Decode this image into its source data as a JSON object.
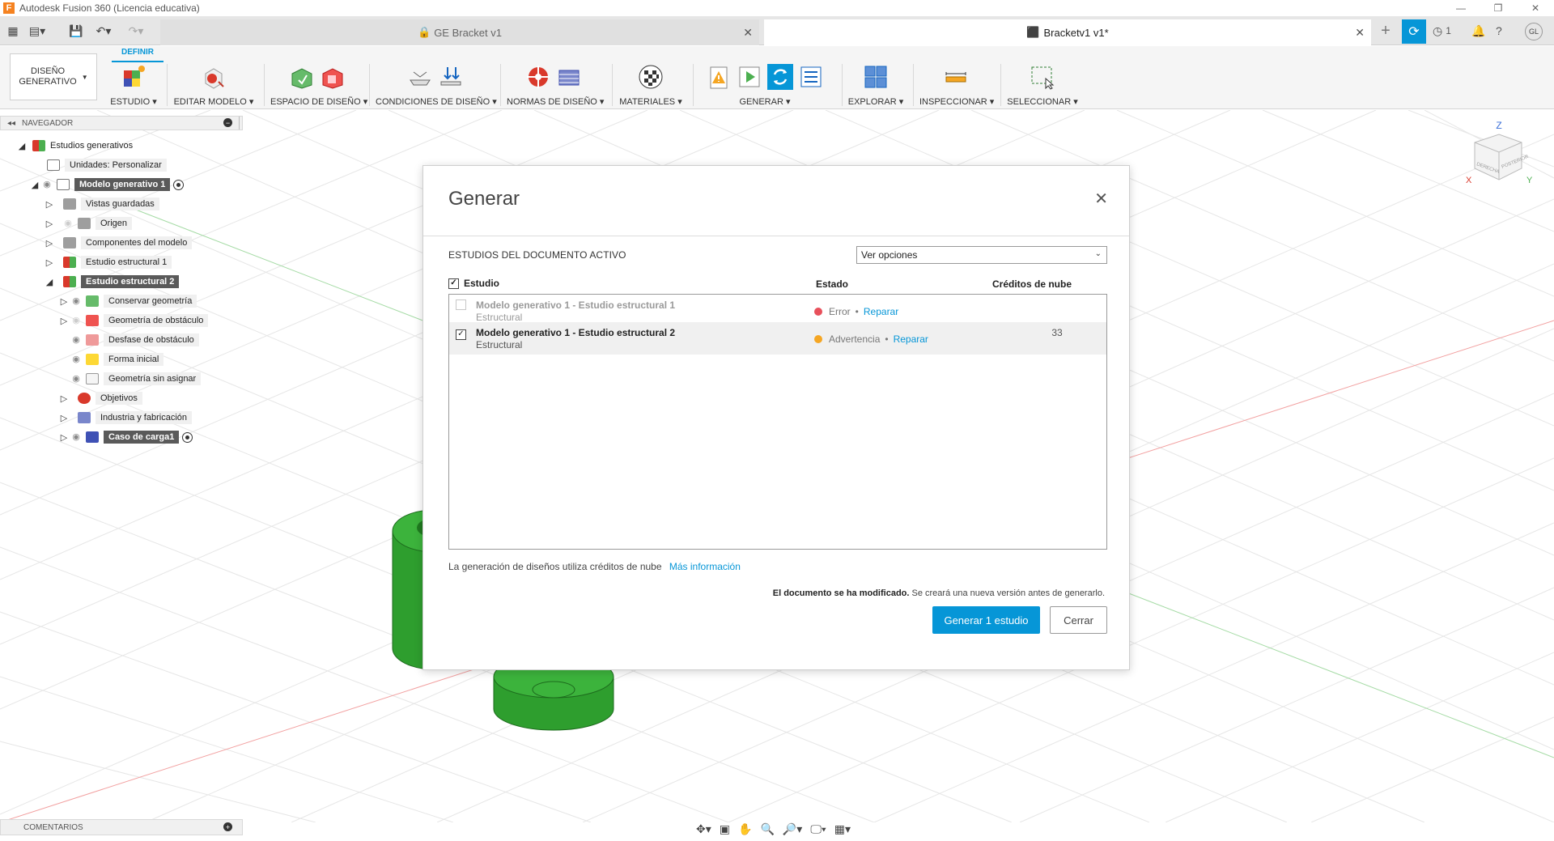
{
  "window": {
    "title": "Autodesk Fusion 360 (Licencia educativa)",
    "app_icon": "F",
    "controls": [
      "minimize-icon",
      "restore-icon",
      "close-icon"
    ]
  },
  "tabs": [
    {
      "label": "GE Bracket v1",
      "icon": "lock-icon",
      "active": false
    },
    {
      "label": "Bracketv1 v1*",
      "icon": "cube-icon",
      "active": true
    }
  ],
  "topbar": {
    "job_count": "1",
    "user_initials": "GL"
  },
  "ribbon": {
    "workspace_line1": "DISEÑO",
    "workspace_line2": "GENERATIVO",
    "active_tab": "DEFINIR",
    "groups": [
      {
        "label": "ESTUDIO ▾"
      },
      {
        "label": "EDITAR MODELO ▾"
      },
      {
        "label": "ESPACIO DE DISEÑO ▾"
      },
      {
        "label": "CONDICIONES DE DISEÑO ▾"
      },
      {
        "label": "NORMAS DE DISEÑO ▾"
      },
      {
        "label": "MATERIALES ▾"
      },
      {
        "label": "GENERAR ▾"
      },
      {
        "label": "EXPLORAR ▾"
      },
      {
        "label": "INSPECCIONAR ▾"
      },
      {
        "label": "SELECCIONAR ▾"
      }
    ]
  },
  "browser": {
    "title": "NAVEGADOR",
    "nodes": [
      {
        "label": "Estudios generativos",
        "expander": "◢",
        "icon_color": "#d9392b"
      },
      {
        "label": "Unidades: Personalizar",
        "expander": "",
        "icon_color": "#ffffff"
      },
      {
        "label": "Modelo generativo 1",
        "expander": "◢",
        "icon_color": "#ffffff",
        "selected": true
      },
      {
        "label": "Vistas guardadas",
        "expander": "▷",
        "icon_color": "#9e9e9e"
      },
      {
        "label": "Origen",
        "expander": "▷",
        "icon_color": "#9e9e9e"
      },
      {
        "label": "Componentes del modelo",
        "expander": "▷",
        "icon_color": "#9e9e9e"
      },
      {
        "label": "Estudio estructural 1",
        "expander": "▷",
        "icon_color": "#d9392b"
      },
      {
        "label": "Estudio estructural 2",
        "expander": "◢",
        "icon_color": "#d9392b",
        "selected": true
      },
      {
        "label": "Conservar geometría",
        "expander": "▷",
        "icon_color": "#4caf50"
      },
      {
        "label": "Geometría de obstáculo",
        "expander": "▷",
        "icon_color": "#e53935"
      },
      {
        "label": "Desfase de obstáculo",
        "expander": "",
        "icon_color": "#ef9a9a"
      },
      {
        "label": "Forma inicial",
        "expander": "",
        "icon_color": "#fdd835"
      },
      {
        "label": "Geometría sin asignar",
        "expander": "",
        "icon_color": "#e0e0e0"
      },
      {
        "label": "Objetivos",
        "expander": "▷",
        "icon_color": "#d9392b"
      },
      {
        "label": "Industria y fabricación",
        "expander": "▷",
        "icon_color": "#5c6bc0"
      },
      {
        "label": "Caso de carga1",
        "expander": "▷",
        "icon_color": "#3f51b5",
        "selected": true
      }
    ]
  },
  "comments": {
    "title": "COMENTARIOS"
  },
  "viewcube": {
    "axis_z": "Z",
    "axis_x": "X",
    "axis_y": "Y",
    "face_right": "DERECHA",
    "face_back": "POSTERIOR"
  },
  "dialog": {
    "title": "Generar",
    "section_label": "ESTUDIOS DEL DOCUMENTO ACTIVO",
    "options_select": "Ver opciones",
    "columns": {
      "study": "Estudio",
      "status": "Estado",
      "credits": "Créditos de nube"
    },
    "rows": [
      {
        "name": "Modelo generativo 1 - Estudio estructural 1",
        "type": "Estructural",
        "status": "Error",
        "status_color": "#e8505b",
        "action": "Reparar",
        "credits": "",
        "checked": false,
        "disabled": true
      },
      {
        "name": "Modelo generativo 1 - Estudio estructural 2",
        "type": "Estructural",
        "status": "Advertencia",
        "status_color": "#f5a623",
        "action": "Reparar",
        "credits": "33",
        "checked": true,
        "disabled": false
      }
    ],
    "credits_info": "La generación de diseños utiliza créditos de nube",
    "more_info_link": "Más información",
    "modified_bold": "El documento se ha modificado.",
    "modified_rest": " Se creará una nueva versión antes de generarlo.",
    "generate_button": "Generar 1 estudio",
    "close_button": "Cerrar"
  },
  "colors": {
    "accent": "#0696d7",
    "model_green": "#2e9e2e"
  }
}
